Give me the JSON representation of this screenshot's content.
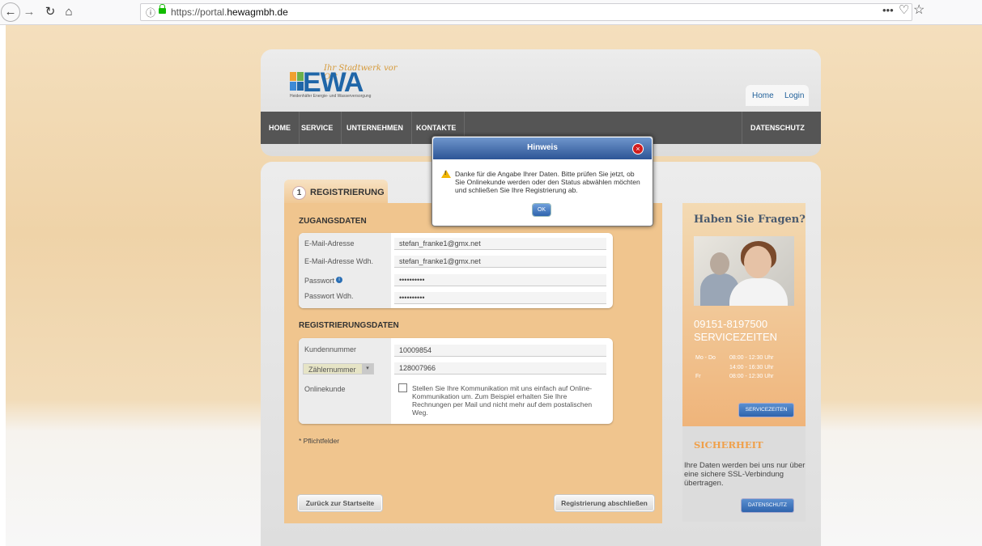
{
  "browser": {
    "url_prefix": "https://portal.",
    "url_domain": "hewagmbh.de"
  },
  "header": {
    "logo_tagline": "Ihr Stadtwerk vor Ort",
    "logo_wordmark": "EWA",
    "logo_subline": "Heidenhäfer Energie- und Wasserversorgung",
    "top_links": {
      "home": "Home",
      "login": "Login"
    },
    "nav": [
      "HOME",
      "SERVICE",
      "UNTERNEHMEN",
      "KONTAKTE"
    ],
    "nav_right": "DATENSCHUTZ"
  },
  "form": {
    "step_number": "1",
    "step_label": "REGISTRIERUNG",
    "access_title": "ZUGANGSDATEN",
    "access_fields": [
      {
        "label": "E-Mail-Adresse",
        "value": "stefan_franke1@gmx.net"
      },
      {
        "label": "E-Mail-Adresse Wdh.",
        "value": "stefan_franke1@gmx.net"
      },
      {
        "label": "Passwort",
        "value": "••••••••••"
      },
      {
        "label": "Passwort Wdh.",
        "value": "••••••••••"
      }
    ],
    "reg_title": "REGISTRIERUNGSDATEN",
    "customer_label": "Kundennummer",
    "customer_value": "10009854",
    "meter_select": "Zählernummer",
    "meter_value": "128007966",
    "online_label": "Onlinekunde",
    "online_text": "Stellen Sie Ihre Kommunikation mit uns einfach auf Online-Kommunikation um. Zum Beispiel erhalten Sie Ihre Rechnungen per Mail und nicht mehr auf dem postalischen Weg.",
    "required_note": "* Pflichtfelder",
    "back_button": "Zurück zur Startseite",
    "finish_button": "Registrierung abschließen"
  },
  "sidebar": {
    "help_title": "Haben Sie Fragen?",
    "phone": "09151-8197500",
    "hours_title": "SERVICEZEITEN",
    "hours": [
      {
        "day": "Mo - Do",
        "time": "08:00 - 12:30 Uhr"
      },
      {
        "day": "",
        "time": "14:00 - 16:30 Uhr"
      },
      {
        "day": "Fr",
        "time": "08:00 - 12:30 Uhr"
      }
    ],
    "service_button": "SERVICEZEITEN",
    "security_title": "SICHERHEIT",
    "security_text": "Ihre Daten werden bei uns nur über eine sichere SSL-Verbindung übertragen.",
    "privacy_button": "DATENSCHUTZ"
  },
  "modal": {
    "title": "Hinweis",
    "message": "Danke für die Angabe Ihrer Daten. Bitte prüfen Sie jetzt, ob Sie Onlinekunde werden oder den Status abwählen möchten und schließen Sie Ihre Registrierung ab.",
    "ok_button": "OK"
  }
}
